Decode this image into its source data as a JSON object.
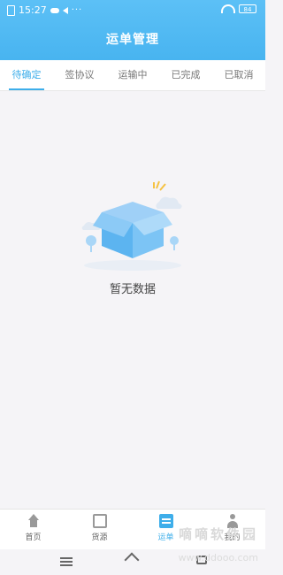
{
  "status": {
    "time": "15:27",
    "dots": "···",
    "battery": "84"
  },
  "header": {
    "title": "运单管理"
  },
  "tabs": [
    {
      "label": "待确定",
      "active": true
    },
    {
      "label": "签协议"
    },
    {
      "label": "运输中"
    },
    {
      "label": "已完成"
    },
    {
      "label": "已取消"
    }
  ],
  "empty_state": {
    "text": "暂无数据"
  },
  "bottom_nav": [
    {
      "label": "首页",
      "icon": "home-icon"
    },
    {
      "label": "货源",
      "icon": "goods-icon"
    },
    {
      "label": "运单",
      "icon": "waybill-icon",
      "active": true
    },
    {
      "label": "我的",
      "icon": "user-icon"
    }
  ],
  "watermark": {
    "text": "嘀嘀软件园",
    "url": "www.ddooo.com"
  },
  "colors": {
    "header": "#48b4f0",
    "accent": "#3eaeea",
    "background": "#f5f4f7"
  }
}
